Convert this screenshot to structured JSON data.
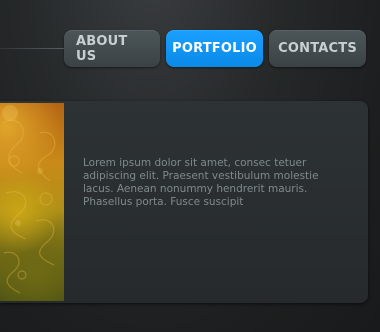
{
  "nav": {
    "items": [
      {
        "label": "ABOUT US",
        "active": false
      },
      {
        "label": "PORTFOLIO",
        "active": true
      },
      {
        "label": "CONTACTS",
        "active": false
      }
    ],
    "active_color": "#1a9cff",
    "inactive_color": "#444d50"
  },
  "panel": {
    "text_lines": [
      "Lorem ipsum dolor sit amet, consec tetuer",
      "adipiscing elit. Praesent vestibulum molestie",
      "lacus. Aenean nonummy hendrerit mauris.",
      "Phasellus porta. Fusce suscipit"
    ],
    "artwork": "ornate-gold-floral-image"
  }
}
